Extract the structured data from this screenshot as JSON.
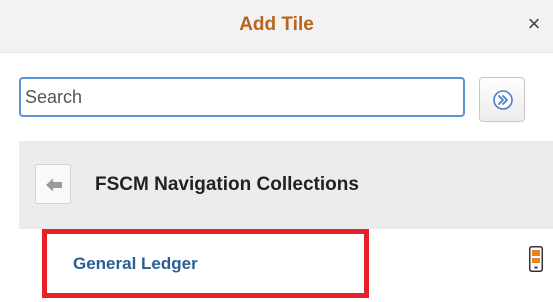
{
  "dialog": {
    "title": "Add Tile",
    "close_label": "×"
  },
  "search": {
    "value": "",
    "placeholder": "Search",
    "go_icon": "double-chevron-right-icon"
  },
  "collection": {
    "back_icon": "arrow-left-icon",
    "title": "FSCM Navigation Collections"
  },
  "items": [
    {
      "label": "General Ledger",
      "icon": "mobile-device-icon"
    }
  ],
  "colors": {
    "title": "#b7651e",
    "link": "#2c5e92",
    "highlight": "#e8202a",
    "search_border": "#5b93d9"
  }
}
